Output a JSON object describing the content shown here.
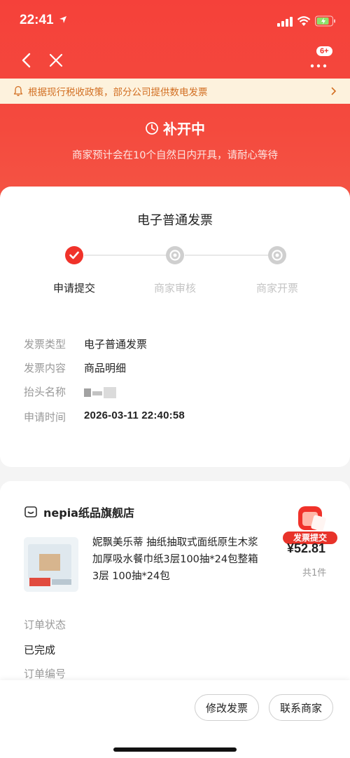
{
  "status_bar": {
    "time": "22:41"
  },
  "nav": {
    "badge": "6+"
  },
  "notice": {
    "text": "根据现行税收政策，部分公司提供数电发票"
  },
  "invoice_status": {
    "title": "补开中",
    "subtitle": "商家预计会在10个自然日内开具，请耐心等待"
  },
  "invoice_card": {
    "title": "电子普通发票",
    "steps": [
      {
        "label": "申请提交",
        "state": "done"
      },
      {
        "label": "商家审核",
        "state": "pending"
      },
      {
        "label": "商家开票",
        "state": "pending"
      }
    ],
    "details": [
      {
        "key": "发票类型",
        "value": "电子普通发票"
      },
      {
        "key": "发票内容",
        "value": "商品明细"
      },
      {
        "key": "抬头名称",
        "value": ""
      },
      {
        "key": "申请时间",
        "value": "2026-03-11 22:40:58"
      }
    ]
  },
  "order_card": {
    "shop_name": "nepia纸品旗舰店",
    "product_title": "妮飘美乐蒂 抽纸抽取式面纸原生木浆加厚吸水餐巾纸3层100抽*24包整箱 3层 100抽*24包",
    "price": "¥52.81",
    "quantity": "共1件",
    "badge_label": "发票提交",
    "order_status_label": "订单状态",
    "order_status_value": "已完成",
    "order_number_label": "订单编号"
  },
  "actions": {
    "edit_invoice": "修改发票",
    "contact_seller": "联系商家"
  },
  "colors": {
    "brand_red": "#f0322a",
    "notice_bg": "#fdf2dd",
    "notice_text": "#d26f22"
  }
}
